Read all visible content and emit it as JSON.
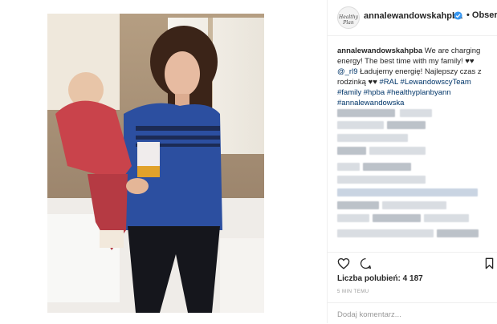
{
  "header": {
    "avatar_text": "Healthy Plan",
    "username": "annalewandowskahpba",
    "follow_label": "• Obserwuj"
  },
  "caption": {
    "username": "annalewandowskahpba",
    "line1": "We are charging energy! The best time with my family! ♥♥",
    "mention": "@_rl9",
    "line2": "Ładujemy energię! Najlepszy czas z rodzinką ♥♥",
    "hashtags": [
      "#RAL",
      "#LewandowscyTeam",
      "#family",
      "#hpba",
      "#healthyplanbyann",
      "#annalewandowska"
    ]
  },
  "stats": {
    "likes_label": "Liczba polubień: 4 187",
    "timestamp": "5 MIN TEMU"
  },
  "comment": {
    "placeholder": "Dodaj komentarz..."
  },
  "colors": {
    "link": "#003569",
    "verified": "#3897f0",
    "muted": "#999999"
  },
  "icons": [
    "heart-icon",
    "comment-icon",
    "bookmark-icon",
    "verified-icon"
  ]
}
